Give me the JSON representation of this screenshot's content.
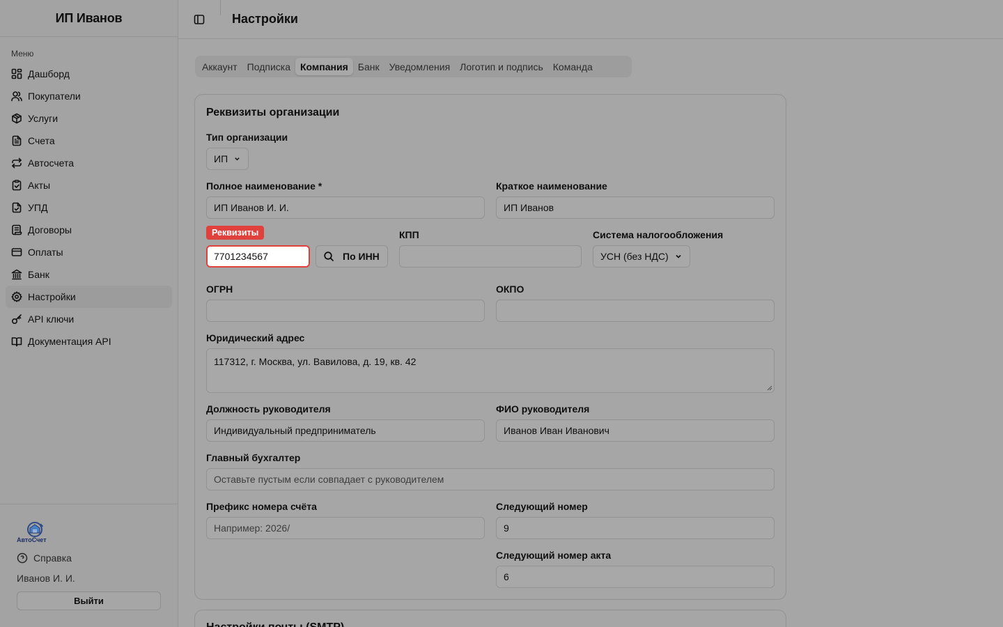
{
  "app": {
    "company": "ИП Иванов"
  },
  "sidebar": {
    "menu_title": "Меню",
    "items": [
      {
        "label": "Дашборд",
        "icon": "dashboard-icon"
      },
      {
        "label": "Покупатели",
        "icon": "users-icon"
      },
      {
        "label": "Услуги",
        "icon": "package-icon"
      },
      {
        "label": "Счета",
        "icon": "file-text-icon"
      },
      {
        "label": "Автосчета",
        "icon": "repeat-icon"
      },
      {
        "label": "Акты",
        "icon": "clipboard-check-icon"
      },
      {
        "label": "УПД",
        "icon": "file-check-icon"
      },
      {
        "label": "Договоры",
        "icon": "scroll-icon"
      },
      {
        "label": "Оплаты",
        "icon": "credit-card-icon"
      },
      {
        "label": "Банк",
        "icon": "bank-icon"
      },
      {
        "label": "Настройки",
        "icon": "gear-icon",
        "active": true
      },
      {
        "label": "API ключи",
        "icon": "key-icon"
      },
      {
        "label": "Документация API",
        "icon": "book-open-icon"
      }
    ],
    "footer": {
      "logo_text": "АвтоСчет",
      "help": "Справка",
      "user": "Иванов И. И.",
      "logout": "Выйти"
    }
  },
  "header": {
    "title": "Настройки"
  },
  "tabs": [
    {
      "label": "Аккаунт"
    },
    {
      "label": "Подписка"
    },
    {
      "label": "Компания",
      "active": true
    },
    {
      "label": "Банк"
    },
    {
      "label": "Уведомления"
    },
    {
      "label": "Логотип и подпись"
    },
    {
      "label": "Команда"
    }
  ],
  "form": {
    "section_title": "Реквизиты организации",
    "org_type": {
      "label": "Тип организации",
      "value": "ИП"
    },
    "full_name": {
      "label": "Полное наименование *",
      "value": "ИП Иванов И. И."
    },
    "short_name": {
      "label": "Краткое наименование",
      "value": "ИП Иванов"
    },
    "inn": {
      "badge": "Реквизиты",
      "value": "7701234567",
      "button": "По ИНН"
    },
    "kpp": {
      "label": "КПП",
      "value": ""
    },
    "tax": {
      "label": "Система налогообложения",
      "value": "УСН (без НДС)"
    },
    "ogrn": {
      "label": "ОГРН",
      "value": ""
    },
    "okpo": {
      "label": "ОКПО",
      "value": ""
    },
    "address": {
      "label": "Юридический адрес",
      "value": "117312, г. Москва, ул. Вавилова, д. 19, кв. 42"
    },
    "head_position": {
      "label": "Должность руководителя",
      "value": "Индивидуальный предприниматель"
    },
    "head_name": {
      "label": "ФИО руководителя",
      "value": "Иванов Иван Иванович"
    },
    "accountant": {
      "label": "Главный бухгалтер",
      "placeholder": "Оставьте пустым если совпадает с руководителем"
    },
    "invoice_prefix": {
      "label": "Префикс номера счёта",
      "placeholder": "Например: 2026/"
    },
    "next_number": {
      "label": "Следующий номер",
      "value": "9"
    },
    "next_act_number": {
      "label": "Следующий номер акта",
      "value": "6"
    }
  },
  "smtp": {
    "title": "Настройки почты (SMTP)"
  }
}
